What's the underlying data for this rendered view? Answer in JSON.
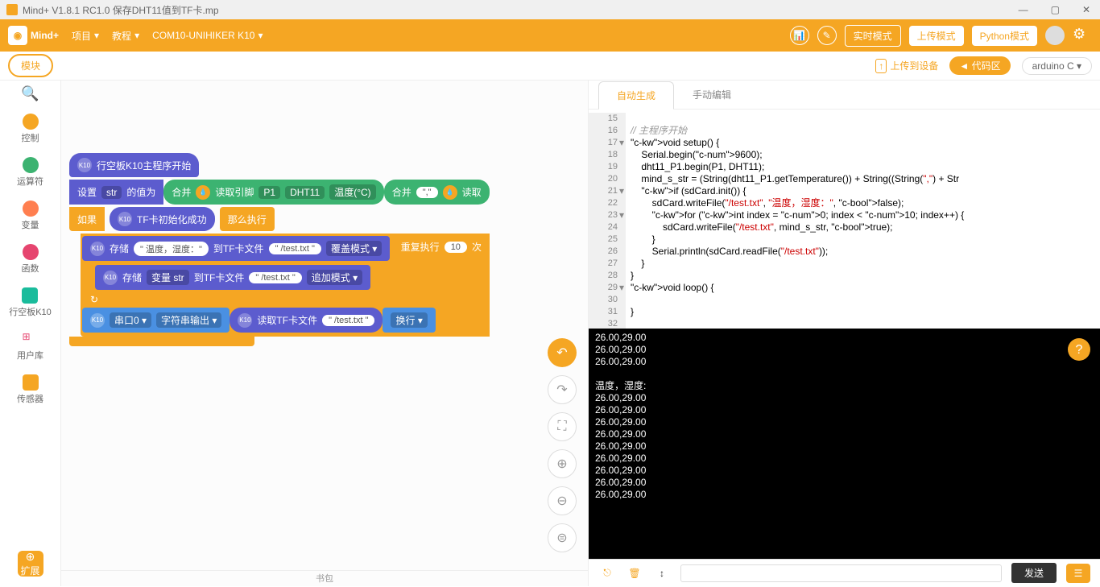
{
  "window": {
    "title": "Mind+ V1.8.1 RC1.0   保存DHT11值到TF卡.mp"
  },
  "header": {
    "logo": "Mind+",
    "menu_project": "项目",
    "menu_tutorial": "教程",
    "menu_port": "COM10-UNIHIKER K10",
    "mode_realtime": "实时模式",
    "mode_upload": "上传模式",
    "mode_python": "Python模式"
  },
  "toolbar": {
    "modules": "模块",
    "upload": "上传到设备",
    "code_area": "代码区",
    "lang": "arduino C"
  },
  "sidebar": {
    "cats": [
      "控制",
      "运算符",
      "变量",
      "函数",
      "行空板K10",
      "用户库",
      "传感器"
    ],
    "extend": "扩展"
  },
  "blocks": {
    "start": "行空板K10主程序开始",
    "set": "设置",
    "str": "str",
    "valto": "的值为",
    "join": "合并",
    "readpin": "读取引脚",
    "p1": "P1",
    "dht11": "DHT11",
    "temp": "温度(°C)",
    "comma": "\",\"",
    "read2": "读取",
    "if": "如果",
    "tfinit": "TF卡初始化成功",
    "then": "那么执行",
    "store": "存储",
    "th_label": "\" 温度，湿度：\"",
    "totf": "到TF卡文件",
    "testfile": "\" /test.txt \"",
    "overwrite": "覆盖模式",
    "repeat": "重复执行",
    "count": "10",
    "times": "次",
    "varstr": "变量 str",
    "append": "追加模式",
    "serial": "串口0",
    "strout": "字符串输出",
    "readtf": "读取TF卡文件",
    "newline": "换行"
  },
  "code_tabs": {
    "auto": "自动生成",
    "manual": "手动编辑"
  },
  "code": [
    {
      "n": 15,
      "t": ""
    },
    {
      "n": 16,
      "t": "// 主程序开始",
      "cls": "c-com"
    },
    {
      "n": 17,
      "t": "void setup() {",
      "f": 1
    },
    {
      "n": 18,
      "t": "    Serial.begin(9600);"
    },
    {
      "n": 19,
      "t": "    dht11_P1.begin(P1, DHT11);"
    },
    {
      "n": 20,
      "t": "    mind_s_str = (String(dht11_P1.getTemperature()) + String((String(\",\") + Str"
    },
    {
      "n": 21,
      "t": "    if (sdCard.init()) {",
      "f": 1
    },
    {
      "n": 22,
      "t": "        sdCard.writeFile(\"/test.txt\", \"温度，湿度：\", false);"
    },
    {
      "n": 23,
      "t": "        for (int index = 0; index < 10; index++) {",
      "f": 1
    },
    {
      "n": 24,
      "t": "            sdCard.writeFile(\"/test.txt\", mind_s_str, true);"
    },
    {
      "n": 25,
      "t": "        }"
    },
    {
      "n": 26,
      "t": "        Serial.println(sdCard.readFile(\"/test.txt\"));"
    },
    {
      "n": 27,
      "t": "    }"
    },
    {
      "n": 28,
      "t": "}"
    },
    {
      "n": 29,
      "t": "void loop() {",
      "f": 1
    },
    {
      "n": 30,
      "t": ""
    },
    {
      "n": 31,
      "t": "}"
    },
    {
      "n": 32,
      "t": ""
    }
  ],
  "terminal": [
    "26.00,29.00",
    "26.00,29.00",
    "26.00,29.00",
    "",
    "温度，湿度:",
    "26.00,29.00",
    "26.00,29.00",
    "26.00,29.00",
    "26.00,29.00",
    "26.00,29.00",
    "26.00,29.00",
    "26.00,29.00",
    "26.00,29.00",
    "26.00,29.00"
  ],
  "footer": {
    "send": "发送"
  },
  "backpack": "书包"
}
